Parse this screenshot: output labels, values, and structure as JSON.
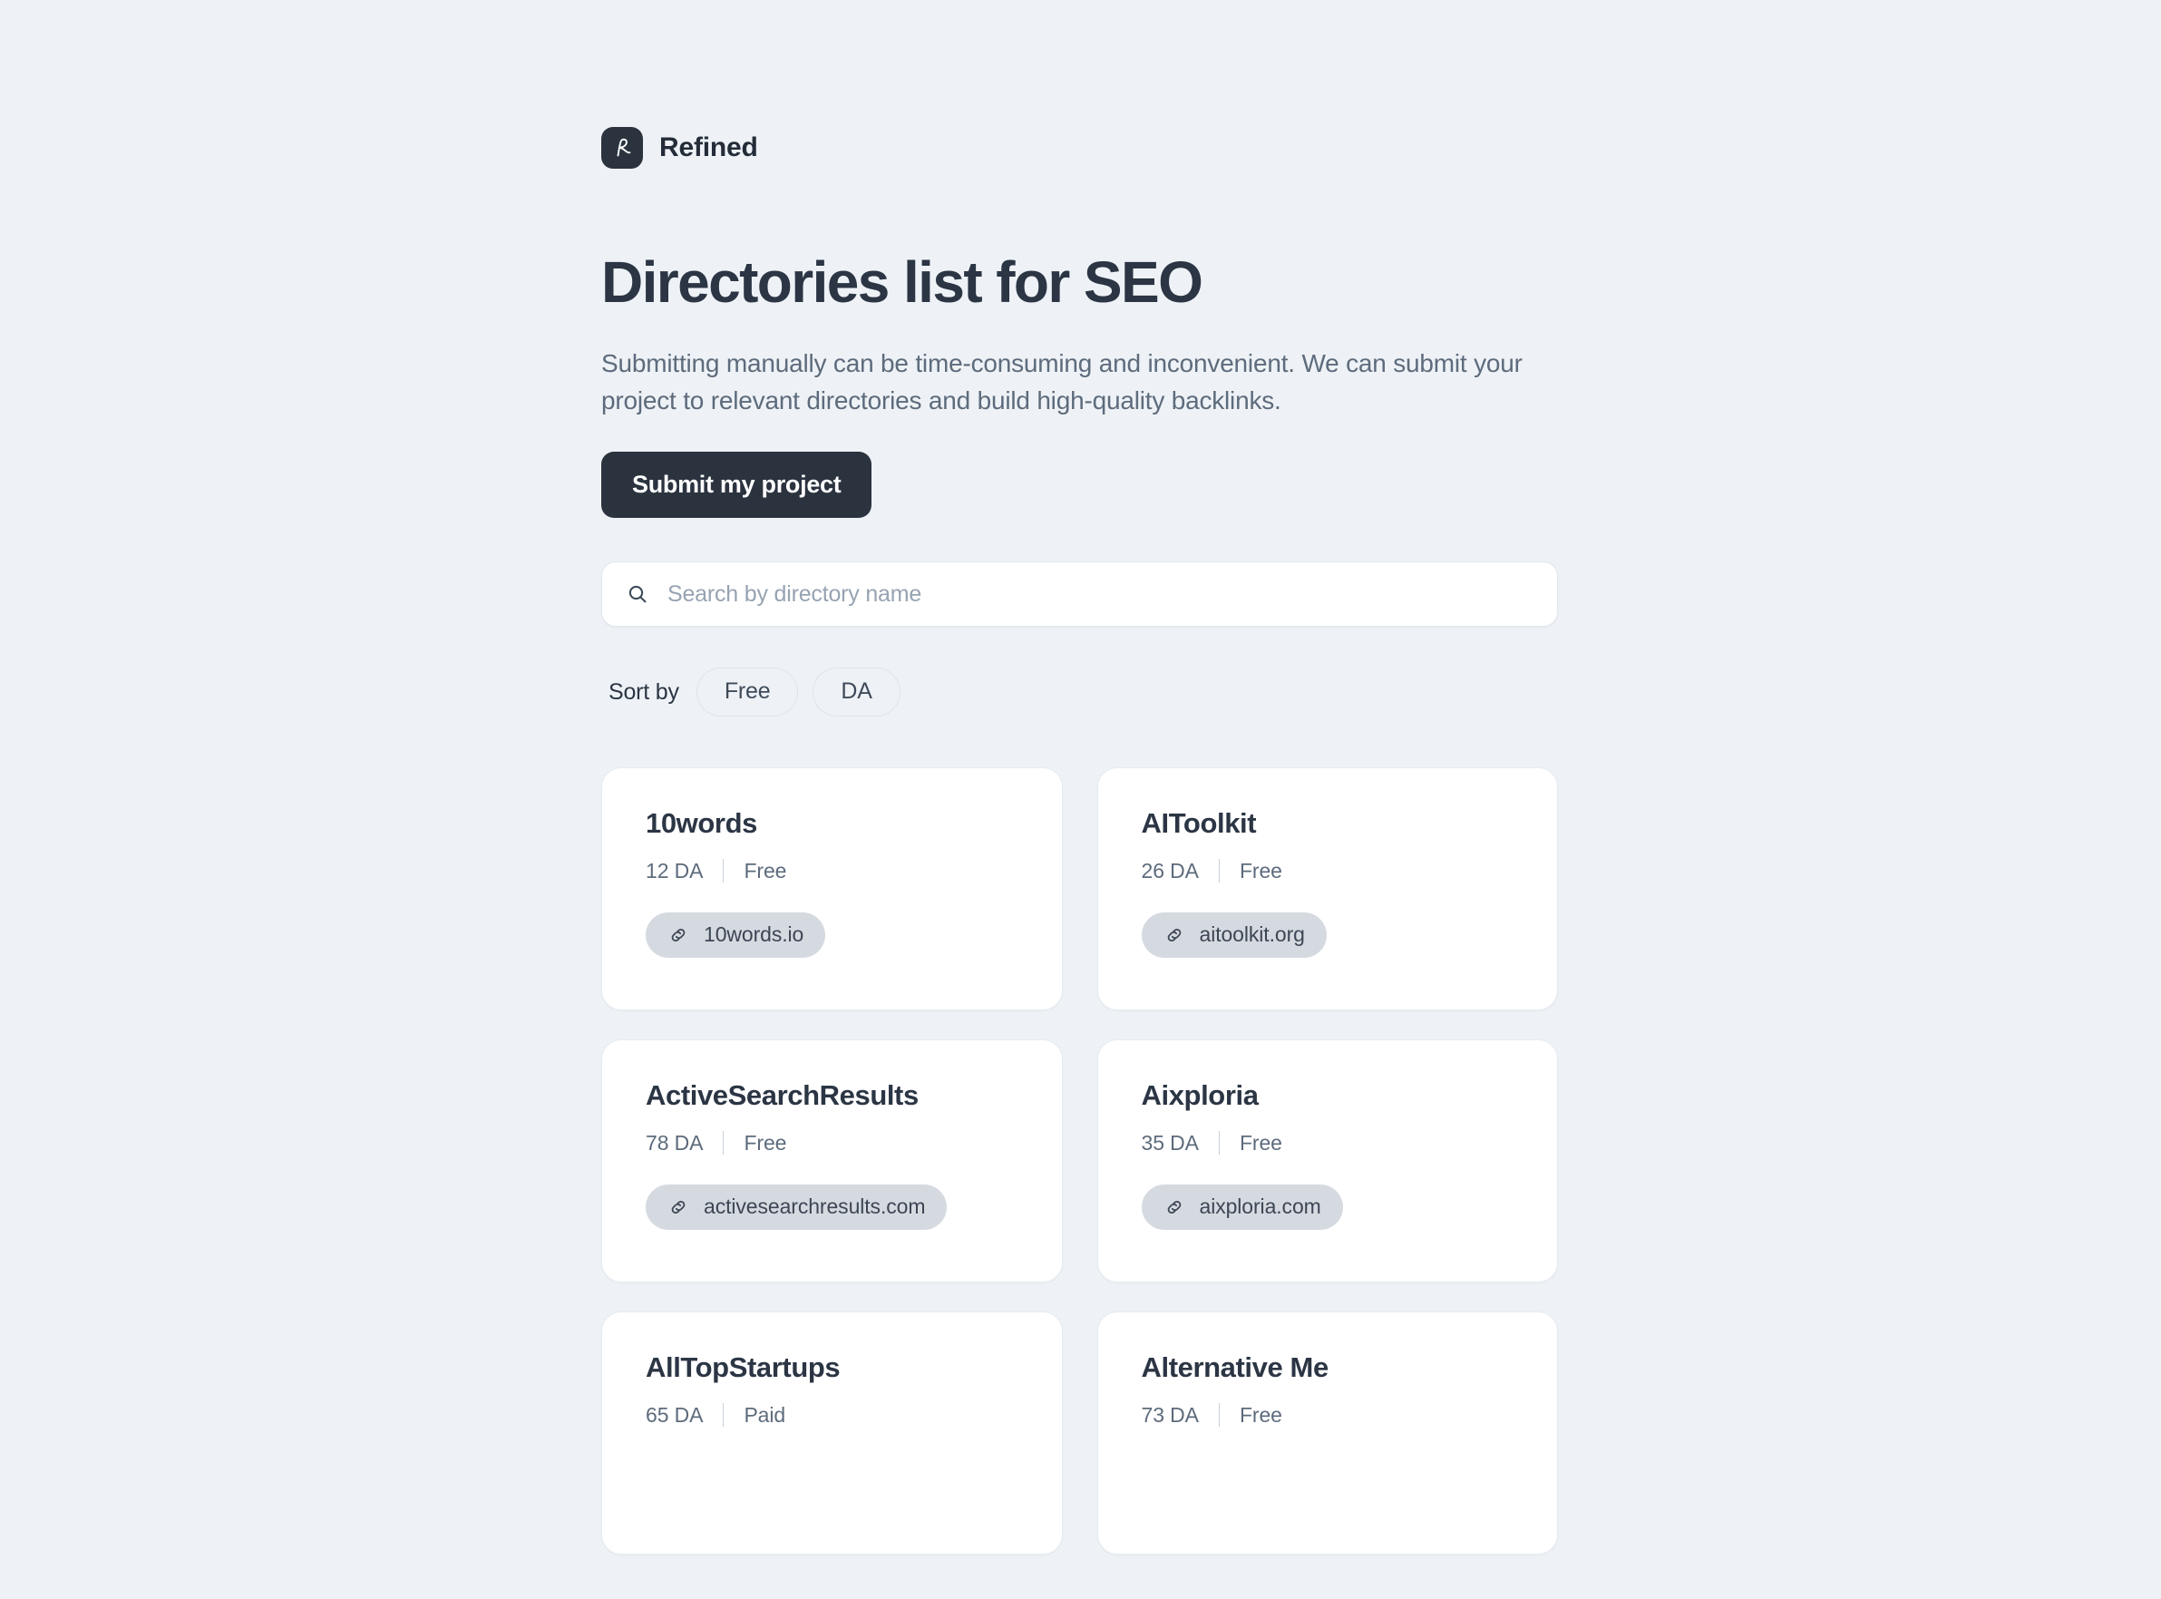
{
  "theme": {
    "background": "#eef2f6",
    "accent_dark": "#2b333f",
    "heading_color": "#2b3544",
    "muted_color": "#5d6b7c",
    "pill_background": "#d5dae0",
    "card_background": "#ffffff"
  },
  "brand": {
    "name": "Refined",
    "mark_icon": "refined-r-logo-icon"
  },
  "hero": {
    "title": "Directories list for SEO",
    "subtitle": "Submitting manually can be time-consuming and inconvenient. We can submit your project to relevant directories and build high-quality backlinks.",
    "cta_label": "Submit my project"
  },
  "search": {
    "icon": "search-icon",
    "placeholder": "Search by directory name",
    "value": ""
  },
  "sort": {
    "label": "Sort by",
    "options": [
      {
        "label": "Free"
      },
      {
        "label": "DA"
      }
    ]
  },
  "directories": [
    {
      "name": "10words",
      "da": "12 DA",
      "price": "Free",
      "domain": "10words.io",
      "link_icon": "link-icon"
    },
    {
      "name": "AIToolkit",
      "da": "26 DA",
      "price": "Free",
      "domain": "aitoolkit.org",
      "link_icon": "link-icon"
    },
    {
      "name": "ActiveSearchResults",
      "da": "78 DA",
      "price": "Free",
      "domain": "activesearchresults.com",
      "link_icon": "link-icon"
    },
    {
      "name": "Aixploria",
      "da": "35 DA",
      "price": "Free",
      "domain": "aixploria.com",
      "link_icon": "link-icon"
    },
    {
      "name": "AllTopStartups",
      "da": "65 DA",
      "price": "Paid",
      "domain": "",
      "link_icon": "link-icon"
    },
    {
      "name": "Alternative Me",
      "da": "73 DA",
      "price": "Free",
      "domain": "",
      "link_icon": "link-icon"
    }
  ]
}
